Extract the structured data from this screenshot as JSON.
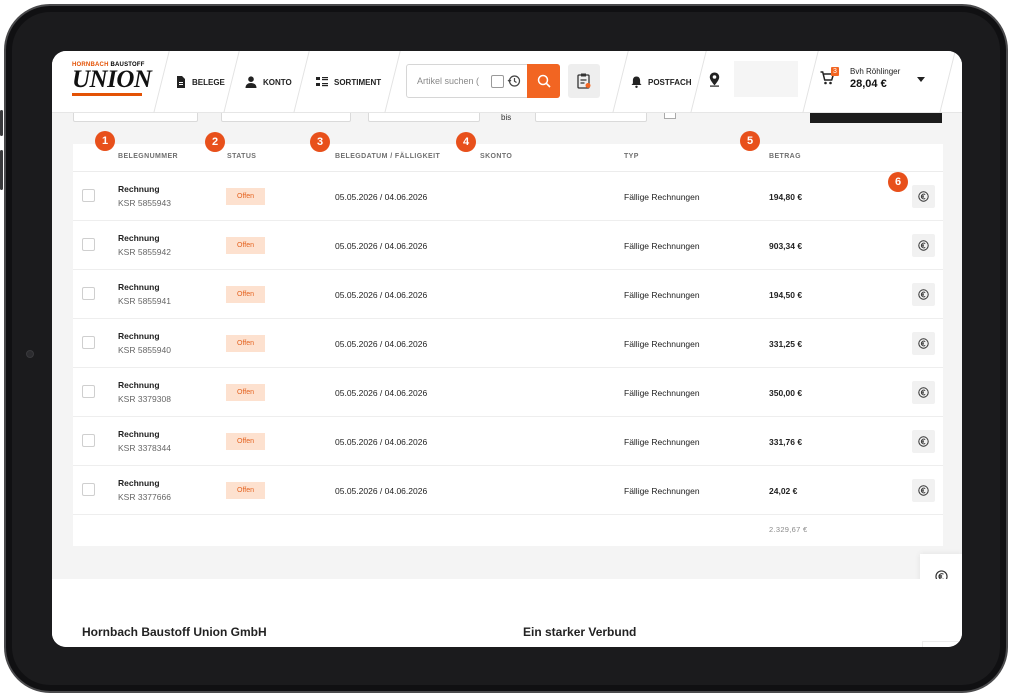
{
  "logo": {
    "top_left": "HORNBACH",
    "top_right": "BAUSTOFF",
    "main": "UNION"
  },
  "nav": {
    "belege": "BELEGE",
    "konto": "KONTO",
    "sortiment": "SORTIMENT",
    "postfach": "POSTFACH"
  },
  "search": {
    "placeholder": "Artikel suchen ("
  },
  "cart": {
    "count": "3",
    "user": "Bvh Röhlinger",
    "total": "28,04 €"
  },
  "filters": {
    "bis": "bis"
  },
  "table": {
    "headers": {
      "belegnummer": "BELEGNUMMER",
      "status": "STATUS",
      "datum": "BELEGDATUM / FÄLLIGKEIT",
      "skonto": "SKONTO",
      "typ": "TYP",
      "betrag": "BETRAG"
    },
    "rows": [
      {
        "type": "Rechnung",
        "number": "KSR 5855943",
        "status": "Offen",
        "date": "05.05.2026 / 04.06.2026",
        "typ": "Fällige Rechnungen",
        "amount": "194,80 €"
      },
      {
        "type": "Rechnung",
        "number": "KSR 5855942",
        "status": "Offen",
        "date": "05.05.2026 / 04.06.2026",
        "typ": "Fällige Rechnungen",
        "amount": "903,34 €"
      },
      {
        "type": "Rechnung",
        "number": "KSR 5855941",
        "status": "Offen",
        "date": "05.05.2026 / 04.06.2026",
        "typ": "Fällige Rechnungen",
        "amount": "194,50 €"
      },
      {
        "type": "Rechnung",
        "number": "KSR 5855940",
        "status": "Offen",
        "date": "05.05.2026 / 04.06.2026",
        "typ": "Fällige Rechnungen",
        "amount": "331,25 €"
      },
      {
        "type": "Rechnung",
        "number": "KSR 3379308",
        "status": "Offen",
        "date": "05.05.2026 / 04.06.2026",
        "typ": "Fällige Rechnungen",
        "amount": "350,00 €"
      },
      {
        "type": "Rechnung",
        "number": "KSR 3378344",
        "status": "Offen",
        "date": "05.05.2026 / 04.06.2026",
        "typ": "Fällige Rechnungen",
        "amount": "331,76 €"
      },
      {
        "type": "Rechnung",
        "number": "KSR 3377666",
        "status": "Offen",
        "date": "05.05.2026 / 04.06.2026",
        "typ": "Fällige Rechnungen",
        "amount": "24,02 €"
      }
    ],
    "total": "2.329,67 €"
  },
  "callouts": [
    "1",
    "2",
    "3",
    "4",
    "5",
    "6"
  ],
  "footer": {
    "company": "Hornbach Baustoff Union GmbH",
    "verbund": "Ein starker Verbund"
  },
  "colors": {
    "accent": "#f26522",
    "badge_bg": "#fde1cf",
    "badge_text": "#e4621f",
    "callout": "#e8501b"
  }
}
